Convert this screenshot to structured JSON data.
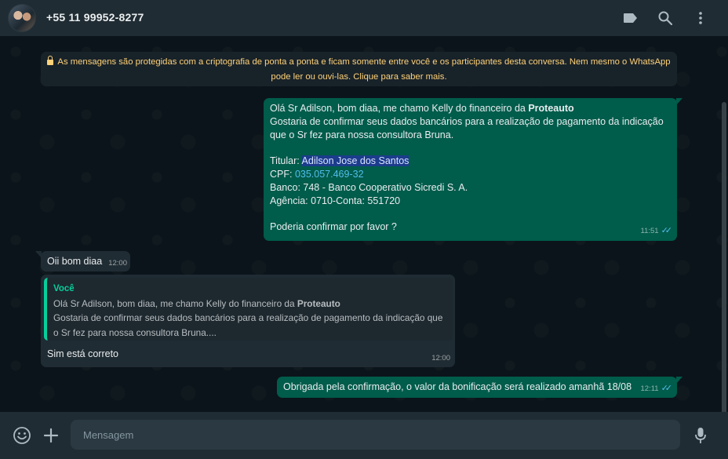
{
  "header": {
    "contact_name": "+55 11 99952-8277"
  },
  "encryption_notice": {
    "line1": "As mensagens são protegidas com a criptografia de ponta a ponta e ficam somente entre você e os participantes desta conversa. Nem mesmo o WhatsApp",
    "line2": "pode ler ou ouvi-las. Clique para saber mais."
  },
  "messages": {
    "m1": {
      "line1_pre": "Olá Sr Adilson, bom diaa, me chamo Kelly do financeiro da ",
      "line1_bold": "Proteauto",
      "line2": "Gostaria de confirmar seus dados bancários para a realização de pagamento da indicação",
      "line3": "que o Sr fez para nossa consultora Bruna.",
      "titular_label": "Titular: ",
      "titular_value": "Adilson Jose dos Santos",
      "cpf_label": "CPF: ",
      "cpf_value": "035.057.469-32",
      "banco": "Banco: 748 - Banco Cooperativo Sicredi S. A.",
      "agencia": "Agência: 0710-Conta: 551720",
      "closing": "Poderia confirmar por favor ?",
      "time": "11:51"
    },
    "m2": {
      "text": "Oii bom diaa",
      "time": "12:00"
    },
    "m3": {
      "quote_author": "Você",
      "quote_line1_pre": "Olá Sr Adilson, bom diaa, me chamo Kelly do financeiro da ",
      "quote_line1_bold": "Proteauto",
      "quote_line2": "Gostaria de confirmar seus dados bancários para a realização de pagamento da indicação que",
      "quote_line3": "o Sr fez para nossa consultora Bruna....",
      "text": "Sim está correto",
      "time": "12:00"
    },
    "m4": {
      "text": "Obrigada pela confirmação, o valor da bonificação será realizado amanhã 18/08",
      "time": "12:11"
    }
  },
  "composer": {
    "placeholder": "Mensagem"
  },
  "colors": {
    "header_bg": "#202c33",
    "chat_bg": "#0b141a",
    "outgoing_bubble": "#005c4b",
    "incoming_bubble": "#202c33",
    "read_ticks": "#53bdeb",
    "notice_text": "#ffd279",
    "quote_accent": "#06cf9c"
  },
  "icons": [
    "label-icon",
    "search-icon",
    "menu-dots-icon",
    "emoji-icon",
    "attach-plus-icon",
    "microphone-icon",
    "lock-icon",
    "double-check-icon"
  ]
}
